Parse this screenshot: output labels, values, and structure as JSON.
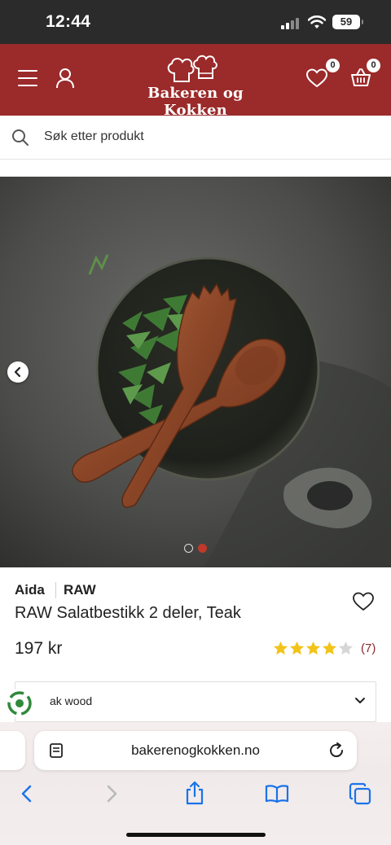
{
  "status_bar": {
    "time": "12:44",
    "battery": "59"
  },
  "header": {
    "logo_text": "Bakeren og Kokken",
    "wishlist_count": "0",
    "cart_count": "0",
    "brand_color": "#9b2a2a",
    "icons": [
      "menu-icon",
      "user-icon",
      "heart-icon",
      "basket-icon"
    ]
  },
  "search": {
    "placeholder": "Søk etter produkt"
  },
  "gallery": {
    "image_count": 2,
    "active_index": 1,
    "active_dot_color": "#c0392b"
  },
  "product": {
    "brand": "Aida",
    "series": "RAW",
    "title": "RAW Salatbestikk 2 deler, Teak",
    "price": "197 kr",
    "rating": 4,
    "rating_max": 5,
    "review_count": "(7)",
    "variant": "ak wood"
  },
  "browser": {
    "url": "bakerenogkokken.no",
    "icons": [
      "back-icon",
      "forward-icon",
      "share-icon",
      "bookmarks-icon",
      "tabs-icon"
    ]
  }
}
